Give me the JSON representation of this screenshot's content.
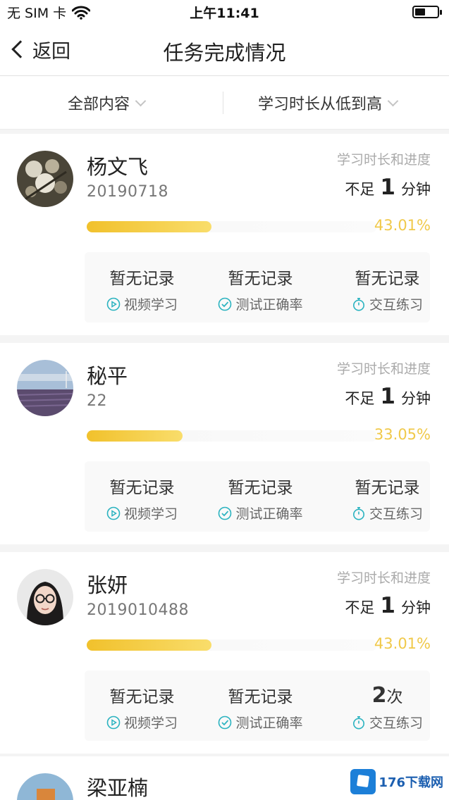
{
  "status_bar": {
    "carrier": "无 SIM 卡",
    "time": "上午11:41"
  },
  "nav": {
    "back_label": "返回",
    "title": "任务完成情况"
  },
  "filters": {
    "left": "全部内容",
    "right": "学习时长从低到高"
  },
  "colors": {
    "accent": "#f1c12c",
    "percent": "#f0c94a",
    "icon": "#2bb3c0"
  },
  "students": [
    {
      "name": "杨文飞",
      "id": "20190718",
      "duration_label": "学习时长和进度",
      "duration_prefix": "不足",
      "duration_value": "1",
      "duration_unit": "分钟",
      "progress_percent": 43.01,
      "percent_text": "43.01%",
      "stats": [
        {
          "value": "暂无记录",
          "label": "视频学习",
          "icon": "play-circle-icon"
        },
        {
          "value": "暂无记录",
          "label": "测试正确率",
          "icon": "check-circle-icon"
        },
        {
          "value": "暂无记录",
          "label": "交互练习",
          "icon": "stopwatch-icon"
        }
      ]
    },
    {
      "name": "秘平",
      "id": "22",
      "duration_label": "学习时长和进度",
      "duration_prefix": "不足",
      "duration_value": "1",
      "duration_unit": "分钟",
      "progress_percent": 33.05,
      "percent_text": "33.05%",
      "stats": [
        {
          "value": "暂无记录",
          "label": "视频学习",
          "icon": "play-circle-icon"
        },
        {
          "value": "暂无记录",
          "label": "测试正确率",
          "icon": "check-circle-icon"
        },
        {
          "value": "暂无记录",
          "label": "交互练习",
          "icon": "stopwatch-icon"
        }
      ]
    },
    {
      "name": "张妍",
      "id": "2019010488",
      "duration_label": "学习时长和进度",
      "duration_prefix": "不足",
      "duration_value": "1",
      "duration_unit": "分钟",
      "progress_percent": 43.01,
      "percent_text": "43.01%",
      "stats": [
        {
          "value": "暂无记录",
          "label": "视频学习",
          "icon": "play-circle-icon"
        },
        {
          "value": "暂无记录",
          "label": "测试正确率",
          "icon": "check-circle-icon"
        },
        {
          "value_num": "2",
          "value_unit": "次",
          "label": "交互练习",
          "icon": "stopwatch-icon"
        }
      ]
    },
    {
      "name": "梁亚楠"
    }
  ],
  "watermark": {
    "text": "176下载网"
  }
}
